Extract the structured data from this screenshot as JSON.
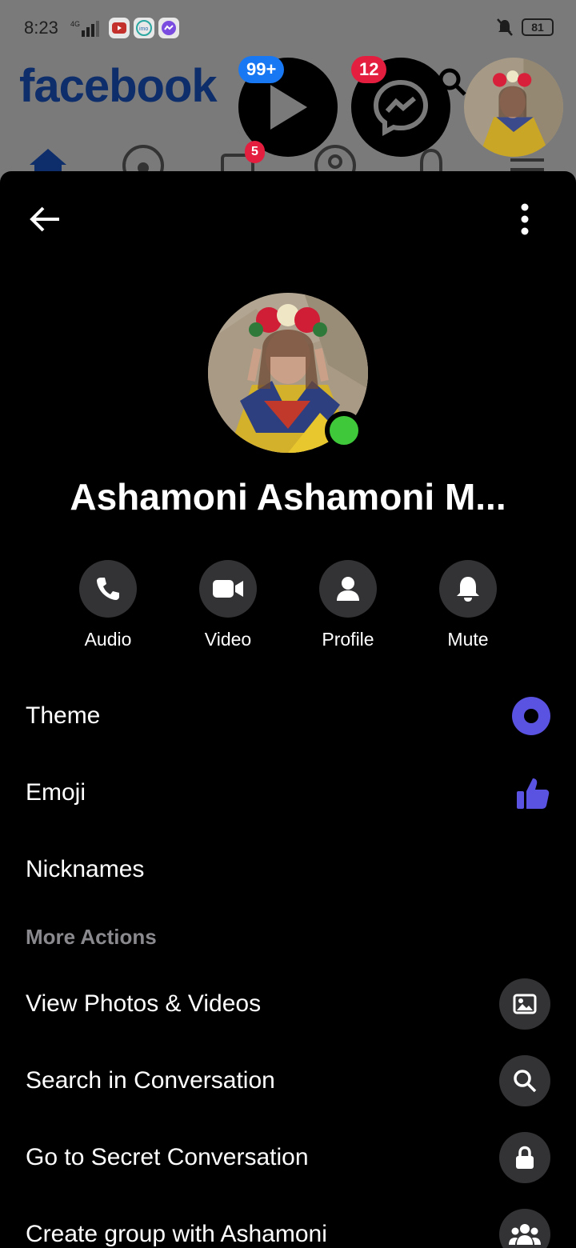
{
  "status_bar": {
    "time": "8:23",
    "network": "4G",
    "battery": "81"
  },
  "background_app": {
    "logo": "facebook",
    "watch_badge": "99+",
    "messenger_badge": "12",
    "video_tab_badge": "5",
    "brand_color": "#1877f2",
    "badge_red": "#e41e3f"
  },
  "header": {
    "back_icon": "arrow-left-icon",
    "menu_icon": "more-vertical-icon"
  },
  "profile": {
    "name": "Ashamoni Ashamoni M...",
    "online": true,
    "online_color": "#3fc93a"
  },
  "actions": [
    {
      "label": "Audio",
      "icon": "phone-icon"
    },
    {
      "label": "Video",
      "icon": "video-camera-icon"
    },
    {
      "label": "Profile",
      "icon": "person-icon"
    },
    {
      "label": "Mute",
      "icon": "bell-icon"
    }
  ],
  "settings": {
    "theme_label": "Theme",
    "theme_color": "#5a52e0",
    "emoji_label": "Emoji",
    "nicknames_label": "Nicknames"
  },
  "more_actions": {
    "title": "More Actions",
    "items": [
      {
        "label": "View Photos & Videos",
        "icon": "image-icon"
      },
      {
        "label": "Search in Conversation",
        "icon": "search-icon"
      },
      {
        "label": "Go to Secret Conversation",
        "icon": "lock-icon"
      },
      {
        "label": "Create group with Ashamoni",
        "icon": "group-icon"
      }
    ]
  }
}
